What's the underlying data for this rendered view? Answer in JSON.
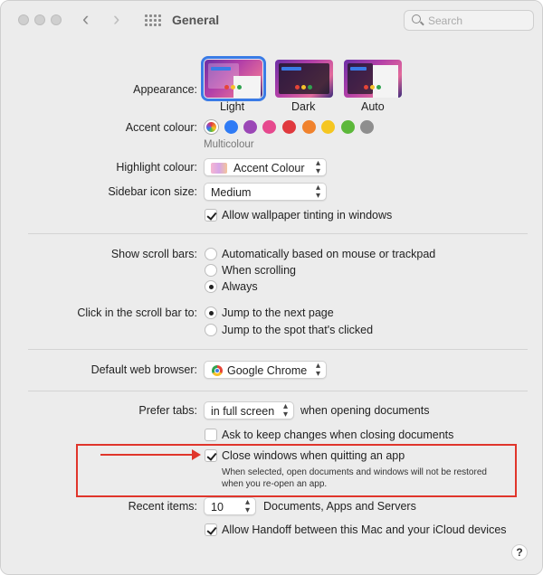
{
  "window": {
    "title": "General",
    "search_placeholder": "Search",
    "back_icon": "chevron-left-icon",
    "forward_icon": "chevron-right-icon",
    "grid_icon": "show-all-grid-icon"
  },
  "appearance": {
    "label": "Appearance:",
    "options": [
      "Light",
      "Dark",
      "Auto"
    ],
    "selected": "Light"
  },
  "accent": {
    "label": "Accent colour:",
    "selected_name": "Multicolour",
    "colors": [
      "multicolour",
      "#2f7bf5",
      "#9b47b6",
      "#e6498e",
      "#e0393e",
      "#f0822d",
      "#f5c621",
      "#5cb83a",
      "#8e8e8e"
    ]
  },
  "highlight": {
    "label": "Highlight colour:",
    "value": "Accent Colour"
  },
  "sidebar_icon": {
    "label": "Sidebar icon size:",
    "value": "Medium"
  },
  "wallpaper_tinting": {
    "label": "Allow wallpaper tinting in windows",
    "checked": true
  },
  "scroll_bars": {
    "label": "Show scroll bars:",
    "options": [
      "Automatically based on mouse or trackpad",
      "When scrolling",
      "Always"
    ],
    "selected": "Always"
  },
  "click_scroll": {
    "label": "Click in the scroll bar to:",
    "options": [
      "Jump to the next page",
      "Jump to the spot that's clicked"
    ],
    "selected": "Jump to the next page"
  },
  "browser": {
    "label": "Default web browser:",
    "value": "Google Chrome"
  },
  "prefer_tabs": {
    "label": "Prefer tabs:",
    "value": "in full screen",
    "suffix": "when opening documents"
  },
  "ask_keep_changes": {
    "label": "Ask to keep changes when closing documents",
    "checked": false
  },
  "close_windows": {
    "label": "Close windows when quitting an app",
    "checked": true,
    "note_line1": "When selected, open documents and windows will not be restored",
    "note_line2": "when you re-open an app."
  },
  "recent_items": {
    "label": "Recent items:",
    "value": "10",
    "suffix": "Documents, Apps and Servers"
  },
  "handoff": {
    "label": "Allow Handoff between this Mac and your iCloud devices",
    "checked": true
  },
  "help": "?",
  "annotation_color": "#e0352b"
}
